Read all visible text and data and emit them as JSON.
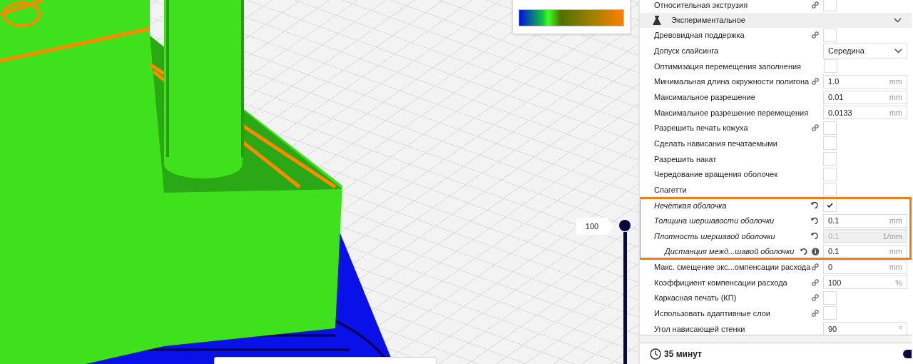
{
  "legend": {
    "kind": "gradient"
  },
  "layer_slider": {
    "value": "100",
    "level": 1
  },
  "settings": {
    "rows_before": [
      {
        "label": "Относительная экструзия",
        "kind": "checkbox",
        "checked": false,
        "link": true,
        "modified": false
      }
    ],
    "section": {
      "title": "Экспериментальное",
      "expanded": true
    },
    "rows": [
      {
        "label": "Древовидная поддержка",
        "kind": "checkbox",
        "checked": false,
        "link": true,
        "modified": false
      },
      {
        "label": "Допуск слайсинга",
        "kind": "dropdown",
        "value": "Середина",
        "link": false,
        "modified": false
      },
      {
        "label": "Оптимизация перемещения заполнения",
        "kind": "checkbox",
        "checked": false,
        "link": false,
        "modified": false
      },
      {
        "label": "Минимальная длина окружности полигона",
        "kind": "number",
        "value": "1.0",
        "unit": "mm",
        "link": true,
        "modified": false
      },
      {
        "label": "Максимальное разрешение",
        "kind": "number",
        "value": "0.01",
        "unit": "mm",
        "link": false,
        "modified": false
      },
      {
        "label": "Максимальное разрешение перемещения",
        "kind": "number",
        "value": "0.0133",
        "unit": "mm",
        "link": false,
        "modified": false
      },
      {
        "label": "Разрешить печать кожуха",
        "kind": "checkbox",
        "checked": false,
        "link": true,
        "modified": false
      },
      {
        "label": "Сделать нависания печатаемыми",
        "kind": "checkbox",
        "checked": false,
        "link": false,
        "modified": false
      },
      {
        "label": "Разрешить накат",
        "kind": "checkbox",
        "checked": false,
        "link": false,
        "modified": false
      },
      {
        "label": "Чередование вращения оболочек",
        "kind": "checkbox",
        "checked": false,
        "link": false,
        "modified": false
      },
      {
        "label": "Спагетти",
        "kind": "checkbox",
        "checked": false,
        "link": false,
        "modified": false
      }
    ],
    "highlighted_rows": [
      {
        "label": "Нечёткая оболочка",
        "kind": "checkbox",
        "checked": true,
        "link": false,
        "modified": true
      },
      {
        "label": "Толщина шершавости оболочки",
        "kind": "number",
        "value": "0.1",
        "unit": "mm",
        "link": false,
        "modified": true,
        "disabled": false
      },
      {
        "label": "Плотность шершавой оболочки",
        "kind": "number",
        "value": "0.1",
        "unit": "1/mm",
        "link": false,
        "modified": true,
        "disabled": true,
        "children": [
          {
            "label": "Дистанция межд...шавой оболочки",
            "kind": "number",
            "value": "0.1",
            "unit": "mm",
            "link": false,
            "modified": true,
            "info": true,
            "disabled": false
          }
        ]
      }
    ],
    "rows_after": [
      {
        "label": "Макс. смещение экс...омпенсации расхода",
        "kind": "number",
        "value": "0",
        "unit": "mm",
        "link": true,
        "modified": false
      },
      {
        "label": "Коэффициент компенсации расхода",
        "kind": "number",
        "value": "100",
        "unit": "%",
        "link": true,
        "modified": false
      },
      {
        "label": "Каркасная печать (КП)",
        "kind": "checkbox",
        "checked": false,
        "link": true,
        "modified": false
      },
      {
        "label": "Использовать адаптивные слои",
        "kind": "checkbox",
        "checked": false,
        "link": true,
        "modified": false
      },
      {
        "label": "Угол нависающей стенки",
        "kind": "number",
        "value": "90",
        "unit": "°",
        "link": false,
        "modified": false
      }
    ]
  },
  "print_summary": {
    "time": "35 минут"
  }
}
